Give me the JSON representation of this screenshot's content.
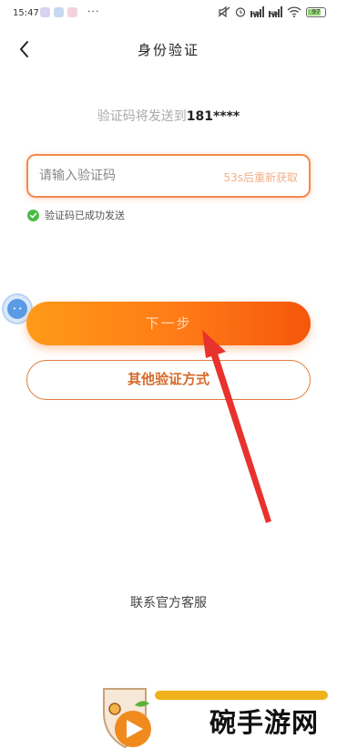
{
  "status_bar": {
    "time": "15:47",
    "more": "···",
    "battery": "97"
  },
  "nav": {
    "back_icon": "chevron-left-icon",
    "title": "身份验证"
  },
  "verification": {
    "sent_prefix": "验证码将发送到",
    "phone": "181****",
    "code_placeholder": "请输入验证码",
    "code_value": "",
    "resend_countdown": "53s后重新获取",
    "success_message": "验证码已成功发送"
  },
  "buttons": {
    "next": "下一步",
    "other_method": "其他验证方式"
  },
  "footer": {
    "contact": "联系官方客服"
  },
  "watermark": {
    "site_name": "碗手游网"
  },
  "colors": {
    "accent_orange": "#ff7a16",
    "success_green": "#4cbb45",
    "arrow_red": "#e8322d"
  }
}
